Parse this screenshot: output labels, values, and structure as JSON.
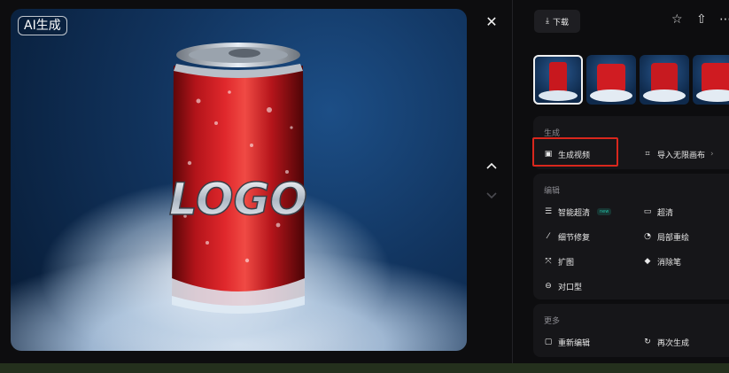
{
  "image": {
    "badge": "AI生成",
    "logo_text": "LOGO"
  },
  "controls": {
    "close_icon": "close-icon",
    "prev_icon": "chevron-up-icon",
    "next_icon": "chevron-down-icon"
  },
  "sidebar": {
    "download_label": "下载",
    "actions": [
      "star-icon",
      "share-icon",
      "more-icon"
    ],
    "thumbnail_count": 4,
    "selected_thumbnail": 0,
    "generate": {
      "title": "生成",
      "generate_video": "生成视频",
      "import_canvas": "导入无限画布"
    },
    "edit": {
      "title": "编辑",
      "smart_hd": "智能超清",
      "smart_hd_tag": "new",
      "hd": "超清",
      "detail_fix": "细节修复",
      "local_redraw": "局部重绘",
      "expand": "扩图",
      "eraser": "消除笔",
      "lip_sync": "对口型"
    },
    "more": {
      "title": "更多",
      "re_edit": "重新编辑",
      "regenerate": "再次生成"
    }
  },
  "colors": {
    "highlight": "#d9271d",
    "background": "#0d0d0f",
    "panel": "#161619"
  }
}
